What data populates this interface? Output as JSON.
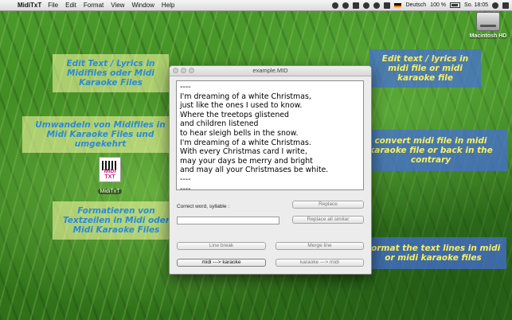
{
  "menubar": {
    "app_name": "MidiTxT",
    "menus": [
      "File",
      "Edit",
      "Format",
      "View",
      "Window",
      "Help"
    ],
    "status": {
      "language": "Deutsch",
      "battery": "100 %",
      "clock": "So. 18:05"
    }
  },
  "desktop": {
    "hd_label": "Macintosh HD",
    "app_icon_label": "MidiTxT",
    "app_icon_text": "MIDI TXT"
  },
  "callouts": {
    "left_1": "Edit Text / Lyrics in Midifiles oder Midi Karaoke Files",
    "left_2": "Umwandeln von Midifiles in Midi Karaoke Files und umgekehrt",
    "left_3": "Formatieren von Textzeilen in Midi oder Midi Karaoke Files",
    "right_1": "Edit text / lyrics in midi file or midi karaoke file",
    "right_2": "convert midi file in midi karaoke file or back in the contrary",
    "right_3": "Format the text lines in midi or midi karaoke files"
  },
  "window": {
    "title": "example.MID",
    "text_content": "----\nI'm dreaming of a white Christmas,\njust like the ones I used to know.\nWhere the treetops glistened\nand children listened\nto hear sleigh bells in the snow.\nI'm dreaming of a white Christmas.\nWith every Christmas card I write,\nmay your days be merry and bright\nand may all your Christmases be white.\n----\n----",
    "correct_label": "Correct word, syllable :",
    "input_value": "",
    "buttons": {
      "replace": "Replace",
      "replace_all": "Replace all similar",
      "line_break": "Line break",
      "merge_line": "Merge line",
      "midi_to_karaoke": "midi ---> karaoke",
      "karaoke_to_midi": "karaoke ---> midi"
    }
  }
}
